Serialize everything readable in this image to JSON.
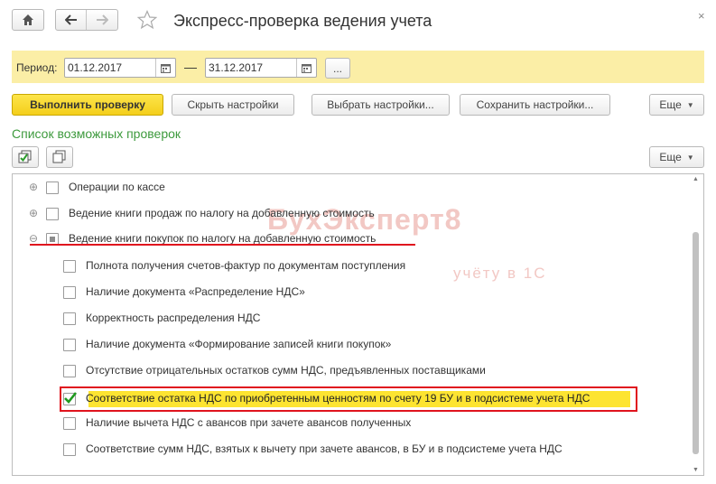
{
  "window": {
    "title": "Экспресс-проверка ведения учета",
    "close_symbol": "×"
  },
  "period": {
    "label": "Период:",
    "from": "01.12.2017",
    "to": "31.12.2017",
    "dash": "—",
    "more": "..."
  },
  "toolbar": {
    "run_label": "Выполнить проверку",
    "hide_label": "Скрыть настройки",
    "choose_label": "Выбрать настройки...",
    "save_label": "Сохранить настройки...",
    "more_label": "Еще"
  },
  "list_section": {
    "title": "Список возможных проверок",
    "more_label": "Еще"
  },
  "watermark": {
    "brand": "БухЭксперт8",
    "tagline": "учёту в 1С"
  },
  "checks": [
    {
      "label": "Операции по кассе",
      "checked": false,
      "expandable": true,
      "expanded": false
    },
    {
      "label": "Ведение книги продаж по налогу на добавленную стоимость",
      "checked": false,
      "expandable": true,
      "expanded": false
    },
    {
      "label": "Ведение книги покупок по налогу на добавленную стоимость",
      "checked": "partial",
      "expandable": true,
      "expanded": true
    },
    {
      "label": "Полнота получения счетов-фактур по документам поступления",
      "checked": false
    },
    {
      "label": "Наличие документа «Распределение НДС»",
      "checked": false
    },
    {
      "label": "Корректность распределения НДС",
      "checked": false
    },
    {
      "label": "Наличие документа «Формирование записей книги покупок»",
      "checked": false
    },
    {
      "label": "Отсутствие отрицательных остатков сумм НДС, предъявленных поставщиками",
      "checked": false
    },
    {
      "label": "Соответствие остатка НДС по приобретенным ценностям по счету 19 БУ и в подсистеме учета НДС",
      "checked": true,
      "highlighted": true
    },
    {
      "label": "Наличие вычета НДС с авансов при зачете авансов полученных",
      "checked": false
    },
    {
      "label": "Соответствие сумм НДС, взятых к вычету при зачете авансов, в БУ и в подсистеме учета НДС",
      "checked": false
    }
  ],
  "colors": {
    "accent_yellow": "#f4cf1b",
    "highlight_red": "#e0141e",
    "section_green": "#3d9a3d",
    "period_bg": "#fbeea6"
  }
}
